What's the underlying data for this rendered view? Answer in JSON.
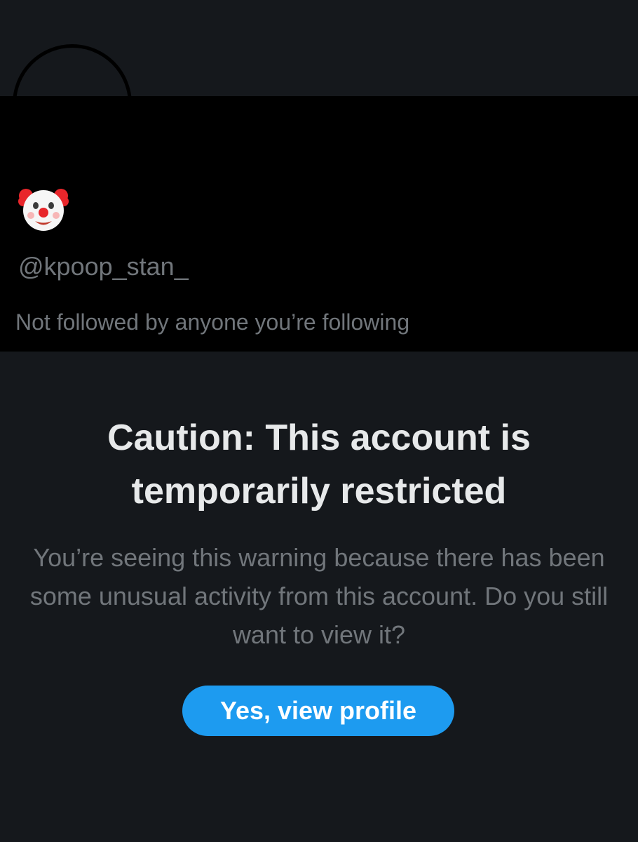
{
  "profile": {
    "display_name_icon": "clown-face-icon",
    "handle": "@kpoop_stan_",
    "follow_note": "Not followed by anyone you’re following"
  },
  "warning": {
    "title": "Caution: This account is temporarily restricted",
    "body": "You’re seeing this warning because there has been some unusual activity from this account. Do you still want to view it?",
    "button_label": "Yes, view profile"
  },
  "colors": {
    "background": "#15181c",
    "profile_background": "#000000",
    "title_text": "#e7e9ea",
    "secondary_text": "#71767b",
    "accent": "#1d9bf0"
  }
}
